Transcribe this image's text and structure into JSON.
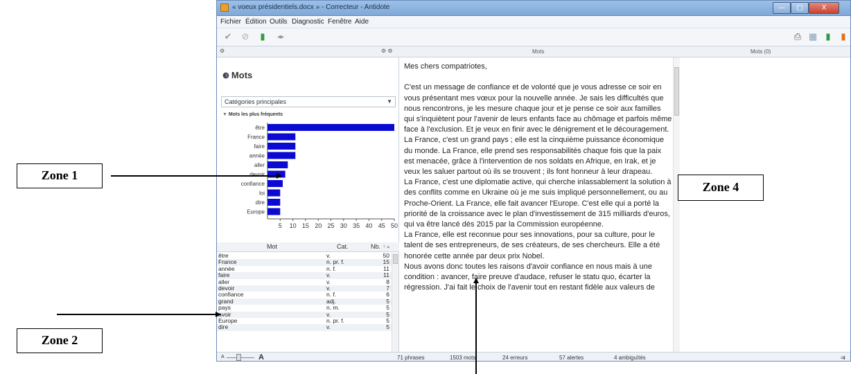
{
  "window": {
    "title": "« voeux présidentiels.docx » - Correcteur - Antidote",
    "min_glyph": "—",
    "max_glyph": "□",
    "close_glyph": "X"
  },
  "menu": [
    "Fichier",
    "Édition",
    "Outils",
    "Diagnostic",
    "Fenêtre",
    "Aide"
  ],
  "panes": {
    "center_header": "Mots",
    "right_header": "Mots (0)"
  },
  "left": {
    "title": "Mots",
    "combo_value": "Catégories principales",
    "section_label": "Mots les plus fréquents",
    "table_headers": [
      "Mot",
      "Cat.",
      "Nb."
    ],
    "table_rows": [
      [
        "être",
        "v.",
        "50"
      ],
      [
        "France",
        "n. pr. f.",
        "15"
      ],
      [
        "année",
        "n. f.",
        "11"
      ],
      [
        "faire",
        "v.",
        "11"
      ],
      [
        "aller",
        "v.",
        "8"
      ],
      [
        "devoir",
        "v.",
        "7"
      ],
      [
        "confiance",
        "n. f.",
        "6"
      ],
      [
        "grand",
        "adj.",
        "5"
      ],
      [
        "pays",
        "n. m.",
        "5"
      ],
      [
        "avoir",
        "v.",
        "5"
      ],
      [
        "Europe",
        "n. pr. f.",
        "5"
      ],
      [
        "dire",
        "v.",
        "5"
      ]
    ]
  },
  "chart_data": {
    "type": "bar",
    "orientation": "horizontal",
    "categories": [
      "être",
      "France",
      "faire",
      "année",
      "aller",
      "devoir",
      "confiance",
      "loi",
      "dire",
      "Europe"
    ],
    "values": [
      50,
      11,
      11,
      11,
      8,
      7,
      6,
      5,
      5,
      5
    ],
    "xticks": [
      5,
      10,
      15,
      20,
      25,
      30,
      35,
      40,
      45,
      50
    ],
    "xlim": [
      0,
      50
    ],
    "bar_color": "#0a0ad2"
  },
  "document": {
    "paragraphs": [
      "Mes chers compatriotes,",
      "",
      "C'est un message de confiance et de volonté que je vous adresse ce soir en vous présentant mes vœux pour la nouvelle année. Je sais les difficultés que nous rencontrons, je les mesure chaque jour et je pense ce soir aux familles qui s'inquiètent pour l'avenir de leurs enfants face au chômage et parfois même face à l'exclusion. Et je veux en finir avec le dénigrement et le découragement.",
      "La France, c'est un grand pays ; elle est la cinquième puissance économique du monde. La France, elle prend ses responsabilités chaque fois que la paix est menacée, grâce à l'intervention de nos soldats en Afrique, en Irak, et je veux les saluer partout où ils se trouvent ; ils font honneur à leur drapeau.",
      "La France, c'est une diplomatie active, qui cherche inlassablement la solution à des conflits comme en Ukraine où je me suis impliqué personnellement, ou au Proche-Orient. La France, elle fait avancer l'Europe. C'est elle qui a porté la priorité de la croissance avec le plan d'investissement de 315 milliards d'euros, qui va être lancé dès 2015 par la Commission européenne.",
      "La France, elle est reconnue pour ses innovations, pour sa culture, pour le talent de ses entrepreneurs, de ses créateurs, de ses chercheurs. Elle a été honorée cette année par deux prix Nobel.",
      "Nous avons donc toutes les raisons d'avoir confiance en nous mais à une condition : avancer, faire preuve d'audace, refuser le statu quo, écarter la régression. J'ai fait le choix de l'avenir tout en restant fidèle aux valeurs de"
    ]
  },
  "status": {
    "font_small": "A",
    "font_large": "A",
    "phrases": "71 phrases",
    "mots": "1503 mots",
    "erreurs": "24 erreurs",
    "alertes": "57 alertes",
    "ambiguites": "4 ambiguïtés"
  },
  "annotations": {
    "zone1": "Zone 1",
    "zone2": "Zone 2",
    "zone4": "Zone 4"
  }
}
